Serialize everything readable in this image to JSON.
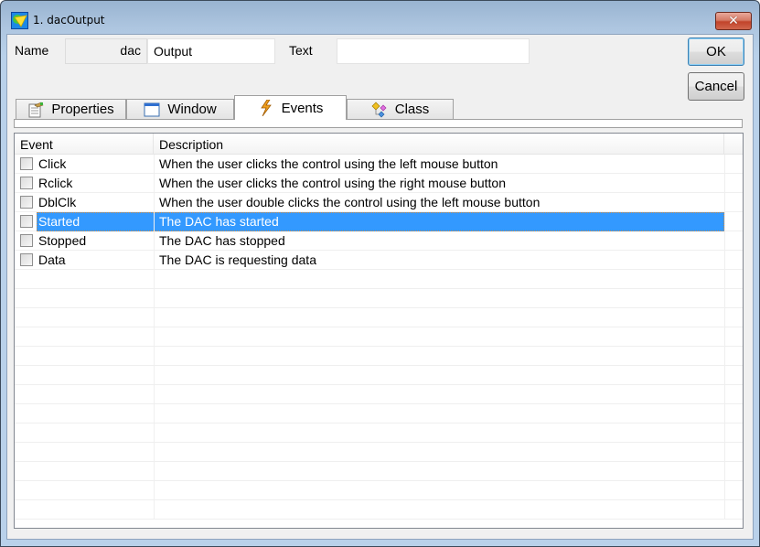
{
  "window": {
    "title": "1. dacOutput",
    "close_label": "✕"
  },
  "form": {
    "name_label": "Name",
    "name_prefix": "dac",
    "name_value": "Output",
    "text_label": "Text",
    "text_value": ""
  },
  "buttons": {
    "ok": "OK",
    "cancel": "Cancel"
  },
  "tabs": [
    {
      "label": "Properties",
      "icon": "properties-icon",
      "active": false
    },
    {
      "label": "Window",
      "icon": "window-icon",
      "active": false
    },
    {
      "label": "Events",
      "icon": "lightning-icon",
      "active": true
    },
    {
      "label": "Class",
      "icon": "class-icon",
      "active": false
    }
  ],
  "events_list": {
    "columns": [
      "Event",
      "Description"
    ],
    "rows": [
      {
        "event": "Click",
        "description": "When the user clicks the control using the left mouse button",
        "checked": false,
        "selected": false
      },
      {
        "event": "Rclick",
        "description": "When the user clicks the control using the right mouse button",
        "checked": false,
        "selected": false
      },
      {
        "event": "DblClk",
        "description": "When the user double clicks the control using the left mouse button",
        "checked": false,
        "selected": false
      },
      {
        "event": "Started",
        "description": "The DAC has started",
        "checked": false,
        "selected": true
      },
      {
        "event": "Stopped",
        "description": "The DAC has stopped",
        "checked": false,
        "selected": false
      },
      {
        "event": "Data",
        "description": "The DAC is requesting data",
        "checked": false,
        "selected": false
      }
    ]
  },
  "colors": {
    "selection": "#3399ff",
    "title_gradient_top": "#99b4d1",
    "client_bg": "#f0f0f0"
  }
}
